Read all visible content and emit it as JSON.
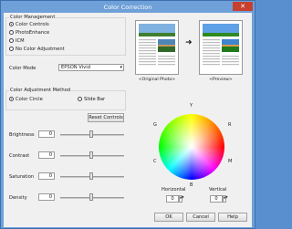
{
  "window": {
    "title": "Color Correction",
    "close_glyph": "✕"
  },
  "color_management": {
    "title": "Color Management",
    "options": [
      {
        "label": "Color Controls",
        "selected": true
      },
      {
        "label": "PhotoEnhance",
        "selected": false
      },
      {
        "label": "ICM",
        "selected": false
      },
      {
        "label": "No Color Adjustment",
        "selected": false
      }
    ]
  },
  "color_mode": {
    "label": "Color Mode",
    "value": "EPSON Vivid"
  },
  "adjustment_method": {
    "title": "Color Adjustment Method",
    "options": [
      {
        "label": "Color Circle",
        "selected": true
      },
      {
        "label": "Slide Bar",
        "selected": false
      }
    ]
  },
  "reset_button": "Reset Controls",
  "sliders": [
    {
      "label": "Brightness",
      "value": "0"
    },
    {
      "label": "Contrast",
      "value": "0"
    },
    {
      "label": "Saturation",
      "value": "0"
    },
    {
      "label": "Density",
      "value": "0"
    }
  ],
  "previews": {
    "original": "<Original Photo>",
    "preview": "<Preview>"
  },
  "wheel_labels": {
    "Y": "Y",
    "G": "G",
    "R": "R",
    "C": "C",
    "M": "M",
    "B": "B"
  },
  "horizontal": {
    "label": "Horizontal",
    "value": "0"
  },
  "vertical": {
    "label": "Vertical",
    "value": "0"
  },
  "buttons": {
    "ok": "OK",
    "cancel": "Cancel",
    "help": "Help"
  }
}
